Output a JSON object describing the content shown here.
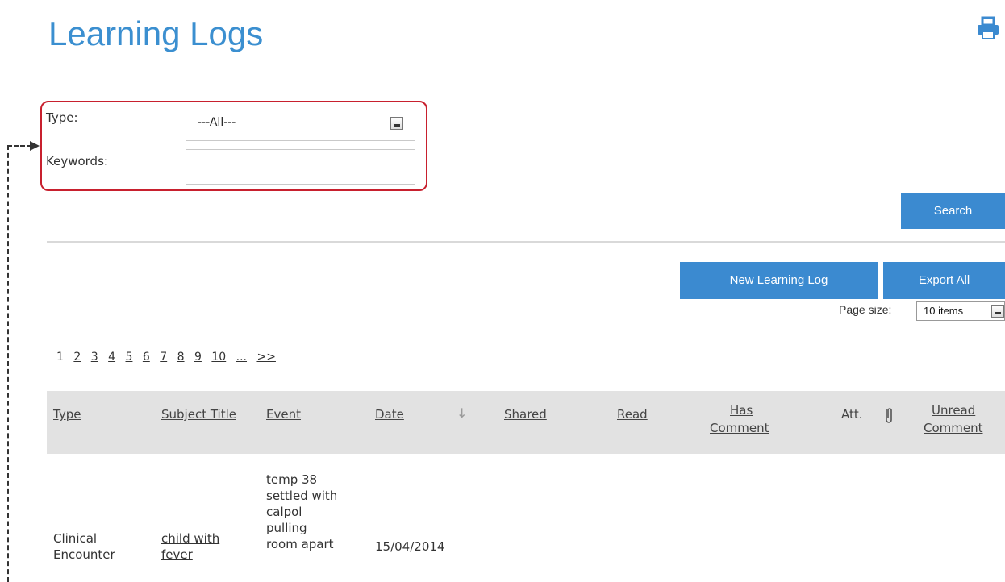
{
  "page": {
    "title": "Learning Logs"
  },
  "filters": {
    "type_label": "Type:",
    "type_value": "---All---",
    "keywords_label": "Keywords:",
    "keywords_value": "",
    "keywords_placeholder": ""
  },
  "actions": {
    "search": "Search",
    "new_learning_log": "New Learning Log",
    "export_all": "Export All"
  },
  "page_size": {
    "label": "Page size:",
    "value": "10 items"
  },
  "pagination": {
    "current": "1",
    "pages": [
      "2",
      "3",
      "4",
      "5",
      "6",
      "7",
      "8",
      "9",
      "10",
      "...",
      ">>"
    ]
  },
  "table": {
    "headers": {
      "type": "Type",
      "subject_title": "Subject Title",
      "event": "Event",
      "date": "Date",
      "shared": "Shared",
      "read": "Read",
      "has_comment_1": "Has",
      "has_comment_2": "Comment",
      "att": "Att.",
      "unread_comment_1": "Unread",
      "unread_comment_2": "Comment"
    },
    "rows": [
      {
        "type_1": "Clinical",
        "type_2": "Encounter",
        "subject_1": "child with",
        "subject_2": "fever",
        "event": [
          "temp 38",
          "settled with",
          "calpol",
          "pulling",
          "room apart"
        ],
        "date": "15/04/2014"
      }
    ]
  },
  "icons": {
    "print": "print-icon",
    "sort": "sort-down-icon",
    "attachment": "paperclip-icon"
  },
  "colors": {
    "accent": "#3b8ad0",
    "highlight_border": "#c8202e"
  }
}
